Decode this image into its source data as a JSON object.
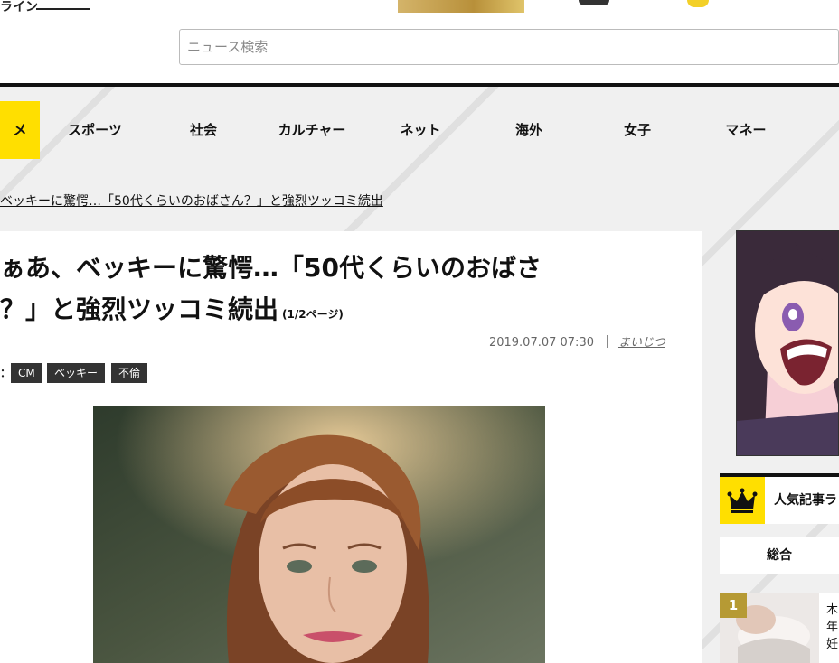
{
  "header": {
    "site_tag": "ライン",
    "search": {
      "placeholder": "ニュース検索"
    }
  },
  "nav": {
    "items": [
      {
        "label": "メ",
        "active": true
      },
      {
        "label": "スポーツ"
      },
      {
        "label": "社会"
      },
      {
        "label": "カルチャー"
      },
      {
        "label": "ネット"
      },
      {
        "label": "海外"
      },
      {
        "label": "女子"
      },
      {
        "label": "マネー"
      }
    ]
  },
  "breadcrumb": {
    "current": "ベッキーに驚愕…「50代くらいのおばさん？」と強烈ツッコミ続出"
  },
  "article": {
    "title_line1": "ぁあ、ベッキーに驚愕…「50代くらいのおばさ",
    "title_line2": "？」と強烈ツッコミ続出",
    "page_indicator": "(1/2ページ)",
    "date": "2019.07.07 07:30",
    "author": "まいじつ",
    "tags_label": "：",
    "tags": [
      "CM",
      "ベッキー",
      "不倫"
    ]
  },
  "sidebar": {
    "ranking": {
      "title": "人気記事ラ",
      "tab": "総合",
      "items": [
        {
          "rank": "1",
          "text": "木年妊"
        }
      ]
    }
  },
  "colors": {
    "accent": "#ffdf00",
    "dark": "#111111",
    "tag_bg": "#333333",
    "rank_badge": "#b69a34"
  }
}
